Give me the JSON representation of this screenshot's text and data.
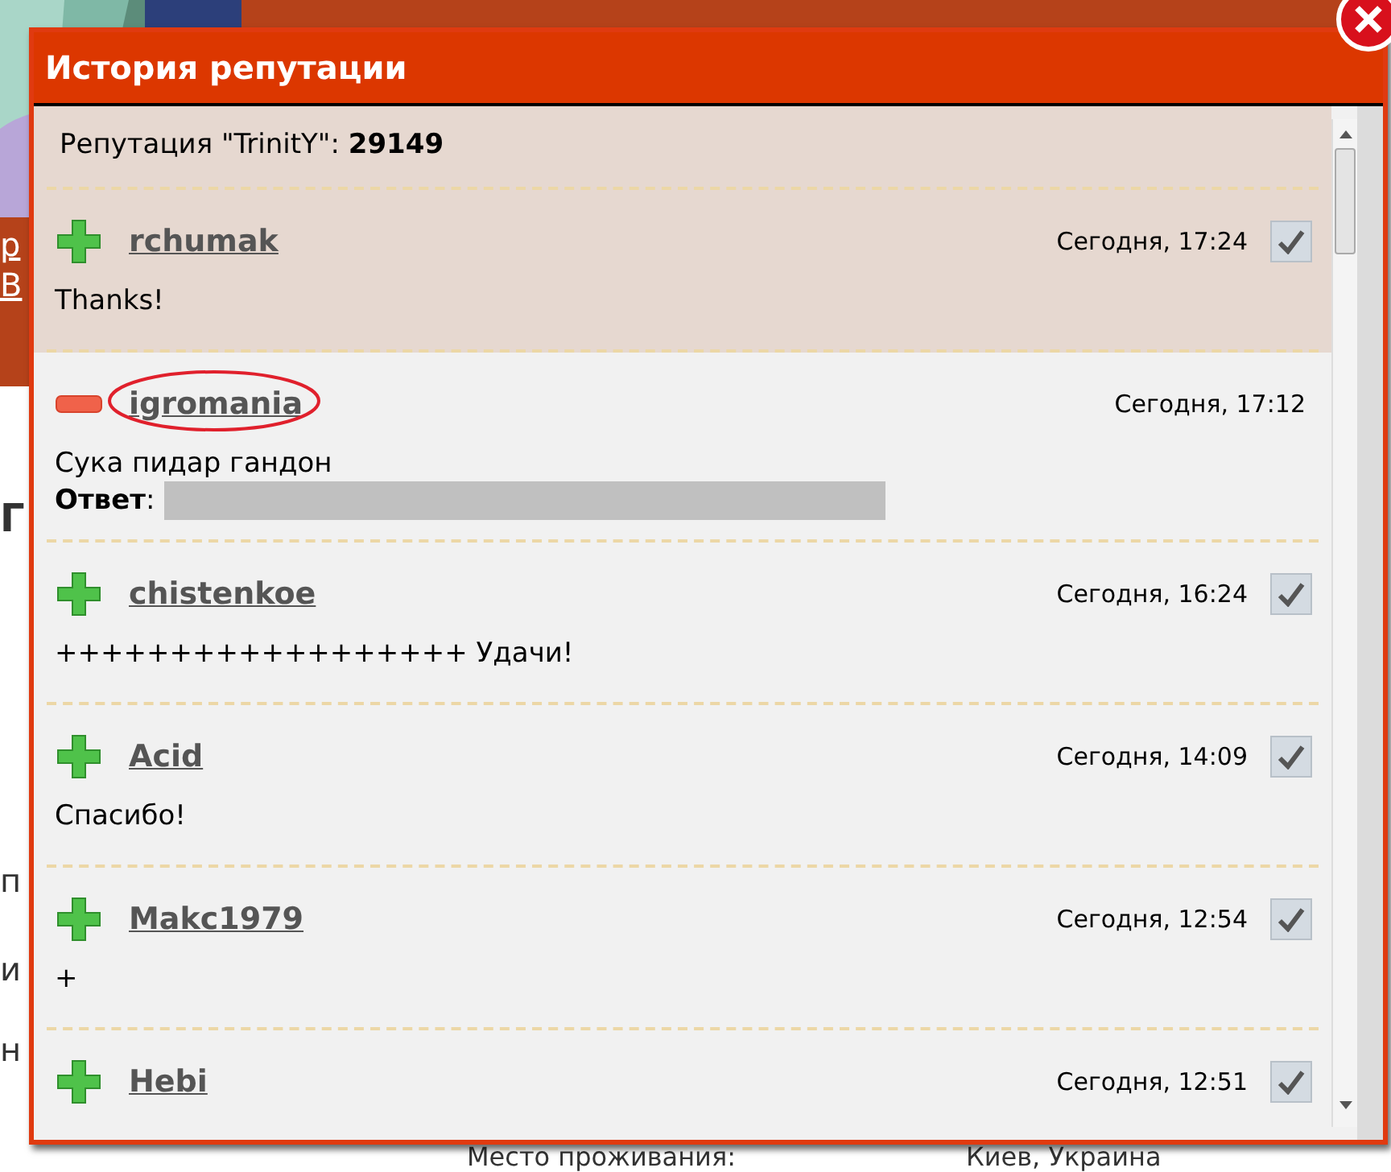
{
  "background": {
    "left_fragments": [
      {
        "text": "р",
        "kind": "link"
      },
      {
        "text": "В",
        "kind": "link"
      },
      {
        "text": "Г",
        "kind": "heading"
      },
      {
        "text": "п",
        "kind": "plain"
      },
      {
        "text": "и",
        "kind": "plain"
      },
      {
        "text": "н",
        "kind": "plain"
      }
    ],
    "bottom_row": {
      "label": "Место проживания:",
      "value": "Киев, Украина"
    }
  },
  "dialog": {
    "title": "История репутации",
    "summary": "Репутация \"TrinitY\": **29149**",
    "entries": [
      {
        "kind": "plus",
        "user": "rchumak",
        "time": "Сегодня, 17:24",
        "checked": true,
        "text": "Thanks!",
        "circled": false
      },
      {
        "kind": "minus",
        "user": "igromania",
        "time": "Сегодня, 17:12",
        "text": "Сука пидар гандон",
        "circled": true,
        "answer": {
          "label": "**Ответ**:",
          "redacted": true
        }
      },
      {
        "kind": "plus",
        "user": "chistenkoe",
        "time": "Сегодня, 16:24",
        "checked": true,
        "text": "++++++++++++++++++ Удачи!",
        "circled": false
      },
      {
        "kind": "plus",
        "user": "Acid",
        "time": "Сегодня, 14:09",
        "checked": true,
        "text": "Спасибо!",
        "circled": false
      },
      {
        "kind": "plus",
        "user": "Makc1979",
        "time": "Сегодня, 12:54",
        "checked": true,
        "text": "+",
        "circled": false
      },
      {
        "kind": "plus",
        "user": "Hebi",
        "time": "Сегодня, 12:51",
        "checked": true,
        "circled": false
      }
    ]
  }
}
